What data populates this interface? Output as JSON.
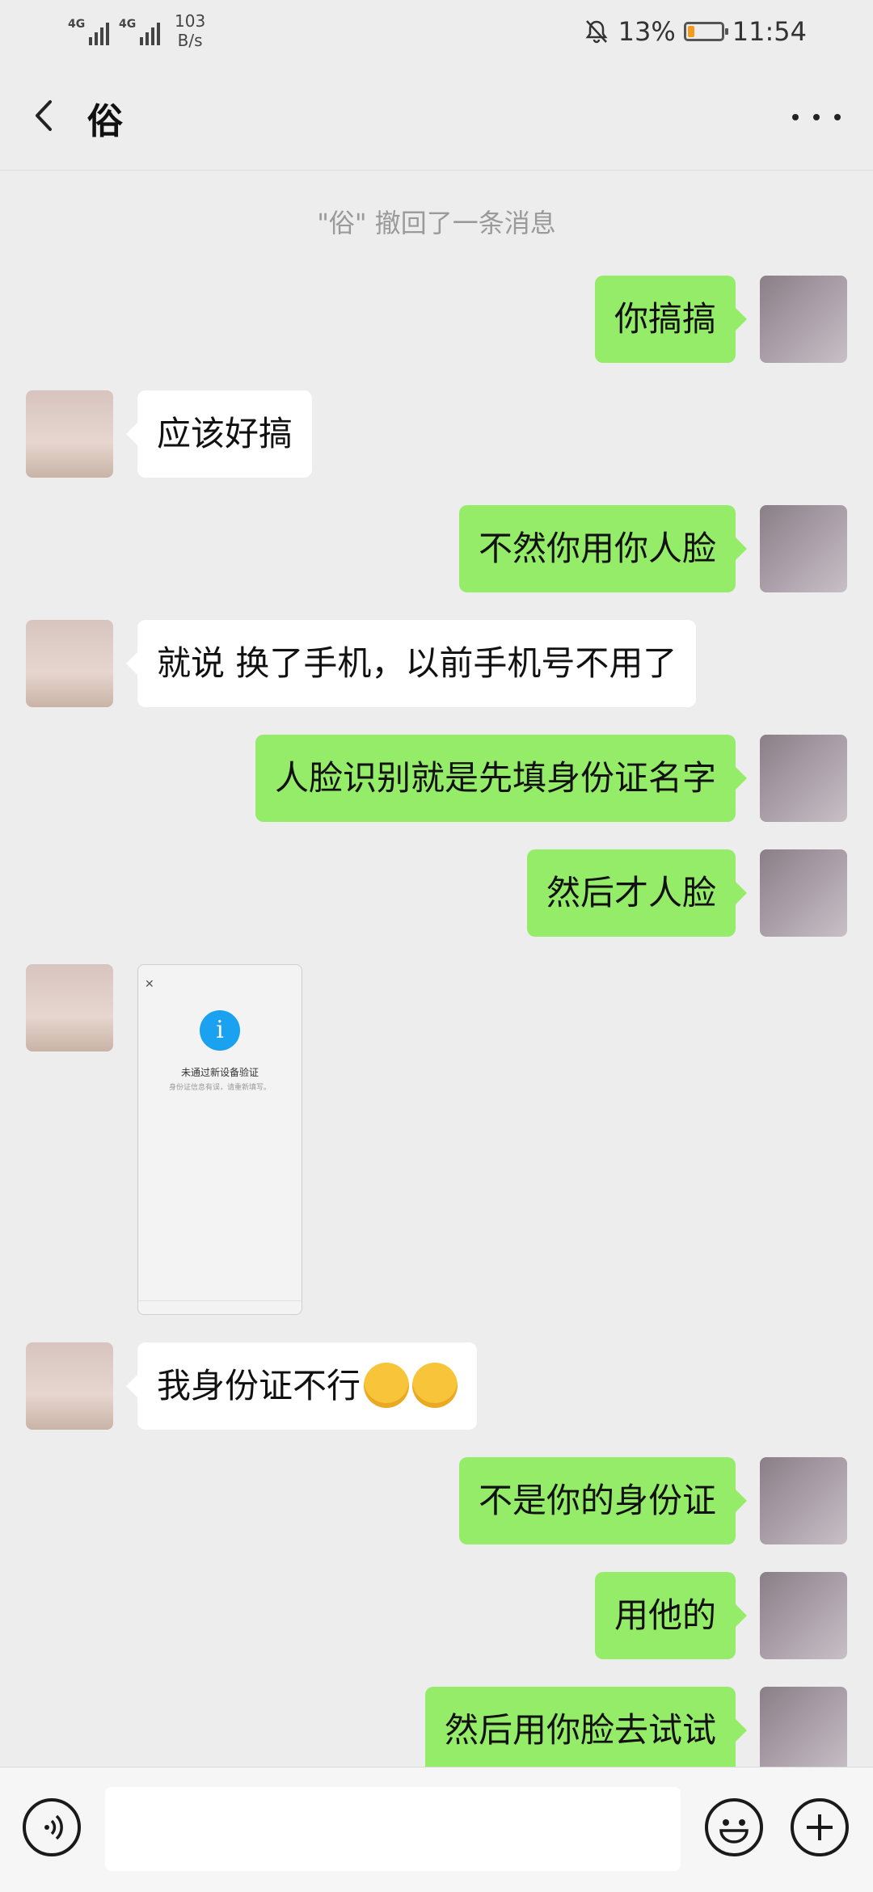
{
  "status_bar": {
    "signal1_label": "4G",
    "signal2_label": "4G",
    "speed_value": "103",
    "speed_unit": "B/s",
    "battery_percent": "13%",
    "battery_level": 0.13,
    "time": "11:54",
    "battery_color": "#f39b1f"
  },
  "header": {
    "title": "俗"
  },
  "chat": {
    "system_notice": "\"俗\" 撤回了一条消息",
    "messages": [
      {
        "from": "me",
        "text": "你搞搞"
      },
      {
        "from": "other",
        "text": "应该好搞"
      },
      {
        "from": "me",
        "text": "不然你用你人脸"
      },
      {
        "from": "other",
        "text": "就说 换了手机，以前手机号不用了"
      },
      {
        "from": "me",
        "text": "人脸识别就是先填身份证名字"
      },
      {
        "from": "me",
        "text": "然后才人脸"
      },
      {
        "from": "other",
        "type": "image",
        "image_title": "未通过新设备验证",
        "image_subtitle": "身份证信息有误，请重新填写。"
      },
      {
        "from": "other",
        "text": "我身份证不行",
        "emoji": [
          "face-with-tears-icon",
          "face-with-tears-icon"
        ]
      },
      {
        "from": "me",
        "text": "不是你的身份证"
      },
      {
        "from": "me",
        "text": "用他的"
      },
      {
        "from": "me",
        "text": "然后用你脸去试试"
      }
    ]
  },
  "colors": {
    "my_bubble": "#95ec69",
    "other_bubble": "#ffffff",
    "background": "#ededed"
  }
}
